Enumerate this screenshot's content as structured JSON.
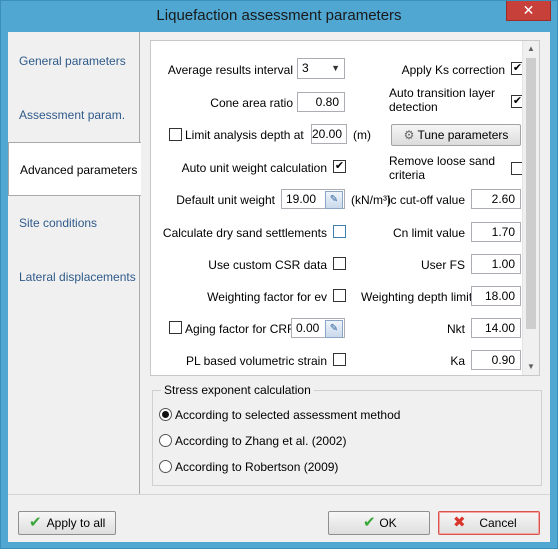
{
  "window": {
    "title": "Liquefaction assessment parameters",
    "close_glyph": "✕"
  },
  "tabs": [
    {
      "label": "General parameters"
    },
    {
      "label": "Assessment param."
    },
    {
      "label": "Advanced parameters"
    },
    {
      "label": "Site conditions"
    },
    {
      "label": "Lateral displacements"
    }
  ],
  "params": {
    "avg_interval_label": "Average results interval",
    "avg_interval_value": "3",
    "apply_ks_label": "Apply Ks correction",
    "apply_ks_checked": "✔",
    "cone_area_label": "Cone area ratio",
    "cone_area_value": "0.80",
    "auto_transition_label_1": "Auto transition layer",
    "auto_transition_label_2": "detection",
    "auto_transition_checked": "✔",
    "limit_depth_label": "Limit analysis depth at",
    "limit_depth_value": "20.00",
    "limit_depth_unit": "(m)",
    "tune_params_label": "Tune parameters",
    "auto_unit_weight_label": "Auto unit weight calculation",
    "auto_unit_weight_checked": "✔",
    "remove_loose_label_1": "Remove loose sand",
    "remove_loose_label_2": "criteria",
    "default_unit_weight_label": "Default unit weight",
    "default_unit_weight_value": "19.00",
    "unit_weight_unit": "(kN/m³)",
    "ic_cutoff_label": "Ic cut-off value",
    "ic_cutoff_value": "2.60",
    "dry_sand_label": "Calculate dry sand settlements",
    "cn_limit_label": "Cn limit value",
    "cn_limit_value": "1.70",
    "custom_csr_label": "Use custom CSR data",
    "user_fs_label": "User FS",
    "user_fs_value": "1.00",
    "weighting_ev_label": "Weighting factor for ev",
    "weighting_depth_label": "Weighting depth limit",
    "weighting_depth_value": "18.00",
    "aging_label": "Aging factor for CRR",
    "aging_value": "0.00",
    "nkt_label": "Nkt",
    "nkt_value": "14.00",
    "pl_strain_label": "PL based volumetric strain",
    "ka_label": "Ka",
    "ka_value": "0.90"
  },
  "stress": {
    "title": "Stress exponent calculation",
    "options": [
      {
        "label": "According to selected assessment method",
        "selected": true
      },
      {
        "label": "According to Zhang et al. (2002)",
        "selected": false
      },
      {
        "label": "According to Robertson (2009)",
        "selected": false
      }
    ]
  },
  "buttons": {
    "apply_all": "Apply to all",
    "ok": "OK",
    "cancel": "Cancel",
    "check_glyph": "✔",
    "cross_glyph": "✖"
  },
  "icons": {
    "edit_icon": "✎",
    "gear_icon": "⚙",
    "scroll_up": "▲",
    "scroll_down": "▼",
    "caret": "▼"
  },
  "colors": {
    "titlebar": "#4fa7d2",
    "close": "#c7403a",
    "tab_link": "#2f5a8a"
  }
}
